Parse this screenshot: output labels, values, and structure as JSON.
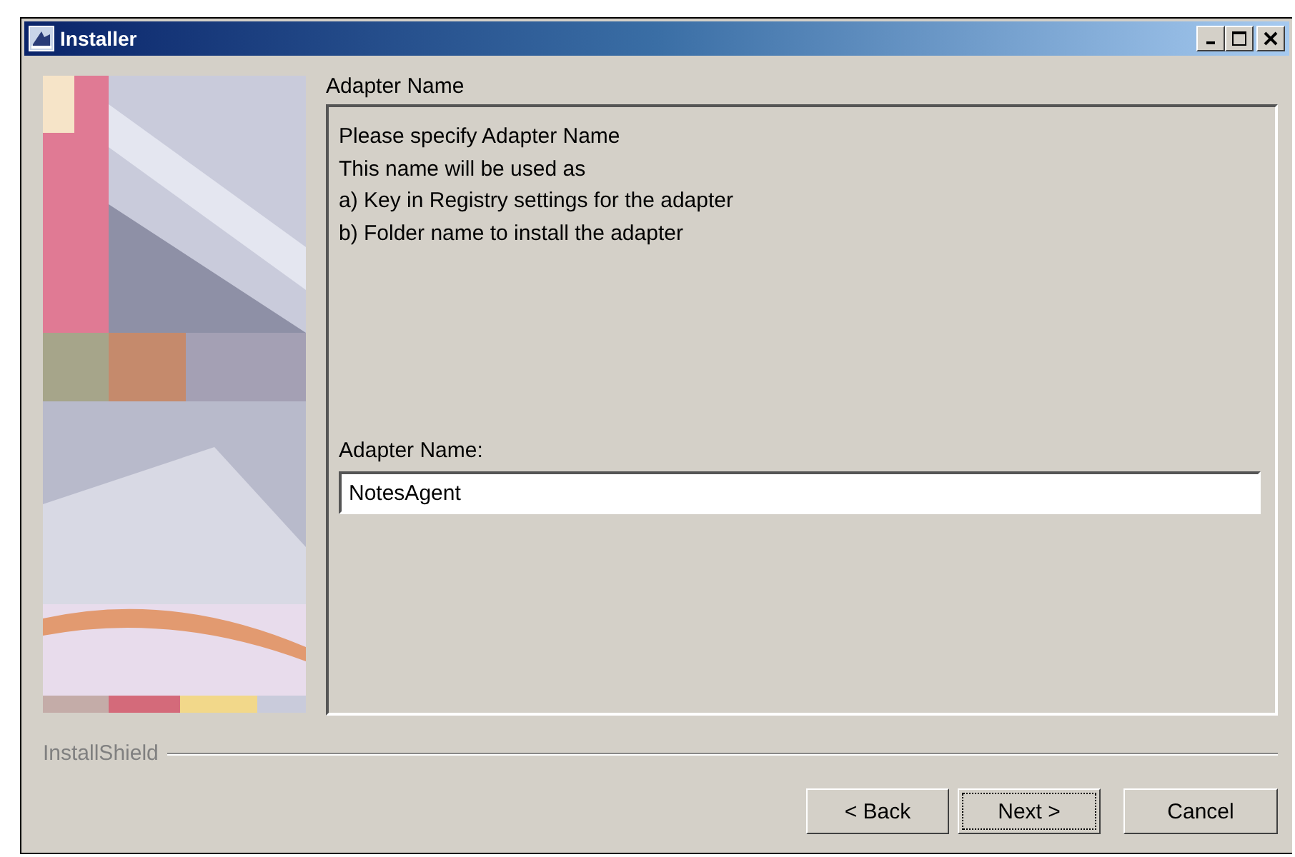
{
  "window": {
    "title": "Installer"
  },
  "section": {
    "title": "Adapter Name",
    "description": [
      "Please specify Adapter Name",
      "This name will be used as",
      "a) Key in Registry settings for the adapter",
      "b) Folder name to install the adapter"
    ],
    "field": {
      "label": "Adapter Name:",
      "value": "NotesAgent"
    }
  },
  "brand": "InstallShield",
  "buttons": [
    {
      "label": "< Back",
      "focused": false
    },
    {
      "label": "Next >",
      "focused": true
    },
    {
      "label": "Cancel",
      "focused": false
    }
  ]
}
